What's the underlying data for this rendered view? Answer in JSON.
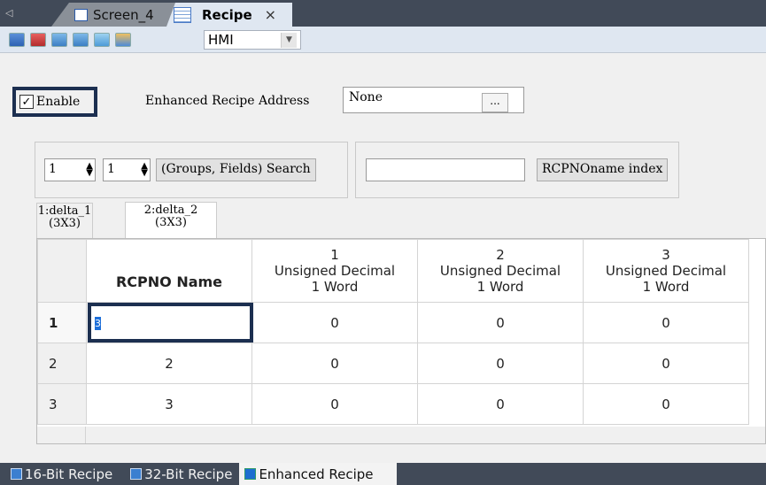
{
  "doc_tabs": [
    {
      "label": "Screen_4",
      "active": false
    },
    {
      "label": "Recipe",
      "active": true,
      "close": "×"
    }
  ],
  "toolbar": {
    "buttons": [
      "add-recipe-icon",
      "delete-recipe-icon",
      "import-icon",
      "export-icon",
      "chart-icon",
      "edit-icon"
    ],
    "target_select": "HMI"
  },
  "settings": {
    "enable_label": "Enable",
    "enable_checked": true,
    "address_label": "Enhanced Recipe Address",
    "address_value": "None",
    "browse_label": "..."
  },
  "search": {
    "groups_value": "1",
    "fields_value": "1",
    "search_button": "(Groups, Fields) Search",
    "name_input": "",
    "name_index_button": "RCPNOname index"
  },
  "sheet_tabs": [
    {
      "line1": "1:delta_1",
      "line2": "(3X3)"
    },
    {
      "line1": "2:delta_2",
      "line2": "(3X3)",
      "active": true
    }
  ],
  "grid": {
    "name_header": "RCPNO Name",
    "columns": [
      {
        "index": "1",
        "type": "Unsigned Decimal",
        "size": "1 Word"
      },
      {
        "index": "2",
        "type": "Unsigned Decimal",
        "size": "1 Word"
      },
      {
        "index": "3",
        "type": "Unsigned Decimal",
        "size": "1 Word"
      }
    ],
    "rows": [
      {
        "num": "1",
        "name": "3",
        "values": [
          "0",
          "0",
          "0"
        ]
      },
      {
        "num": "2",
        "name": "2",
        "values": [
          "0",
          "0",
          "0"
        ]
      },
      {
        "num": "3",
        "name": "3",
        "values": [
          "0",
          "0",
          "0"
        ]
      }
    ]
  },
  "bottom_tabs": [
    {
      "label": "16-Bit Recipe",
      "active": false
    },
    {
      "label": "32-Bit Recipe",
      "active": false
    },
    {
      "label": "Enhanced Recipe",
      "active": true
    }
  ],
  "colors": {
    "tabstrip": "#414a58",
    "highlight_frame": "#1c2f50",
    "selection": "#1e6fd9"
  }
}
